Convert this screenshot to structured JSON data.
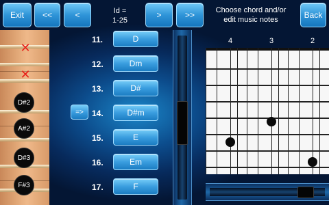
{
  "toolbar": {
    "exit_label": "Exit",
    "first_label": "<<",
    "prev_label": "<",
    "id_line1": "Id =",
    "id_line2": "1-25",
    "next_label": ">",
    "last_label": ">>",
    "title_line1": "Choose chord and/or",
    "title_line2": "edit music notes",
    "back_label": "Back"
  },
  "fretboard": {
    "muted_marker": "✕",
    "notes": [
      "D#2",
      "A#2",
      "D#3",
      "F#3"
    ]
  },
  "chord_list": {
    "select_arrow": "=>",
    "rows": [
      {
        "num": "11.",
        "chord": "D"
      },
      {
        "num": "12.",
        "chord": "Dm"
      },
      {
        "num": "13.",
        "chord": "D#"
      },
      {
        "num": "14.",
        "chord": "D#m"
      },
      {
        "num": "15.",
        "chord": "E"
      },
      {
        "num": "16.",
        "chord": "Em"
      },
      {
        "num": "17.",
        "chord": "F"
      }
    ]
  },
  "diagram": {
    "string_numbers": [
      "4",
      "3",
      "2"
    ]
  },
  "colors": {
    "accent": "#2f94d8",
    "background": "#0c4c8c",
    "mute_mark": "#e8221b"
  }
}
